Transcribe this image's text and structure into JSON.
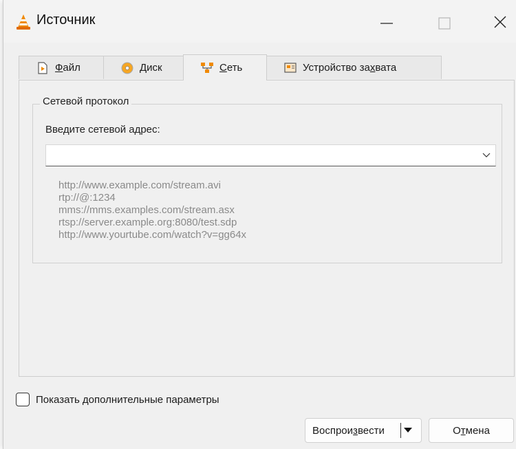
{
  "window": {
    "title": "Источник"
  },
  "tabs": [
    {
      "label_pre": "",
      "label_u": "Ф",
      "label_post": "айл",
      "icon": "file-play-icon"
    },
    {
      "label_pre": "",
      "label_u": "Д",
      "label_post": "иск",
      "icon": "disc-icon"
    },
    {
      "label_pre": "",
      "label_u": "С",
      "label_post": "еть",
      "icon": "network-icon"
    },
    {
      "label_pre": "Устройство за",
      "label_u": "х",
      "label_post": "вата",
      "icon": "capture-device-icon"
    }
  ],
  "active_tab": "Сеть",
  "network": {
    "group_title": "Сетевой протокол",
    "address_label": "Введите сетевой адрес:",
    "address_value": "",
    "examples": [
      "http://www.example.com/stream.avi",
      "rtp://@:1234",
      "mms://mms.examples.com/stream.asx",
      "rtsp://server.example.org:8080/test.sdp",
      "http://www.yourtube.com/watch?v=gg64x"
    ]
  },
  "options": {
    "show_more_label": "Показать дополнительные параметры",
    "show_more_checked": false
  },
  "buttons": {
    "play_pre": "Воспрои",
    "play_u": "з",
    "play_post": "вести",
    "cancel_pre": "О",
    "cancel_u": "т",
    "cancel_post": "мена"
  },
  "colors": {
    "accent_orange": "#f08a00",
    "hint_gray": "#8a8a8a",
    "window_bg": "#f0f0f0"
  }
}
